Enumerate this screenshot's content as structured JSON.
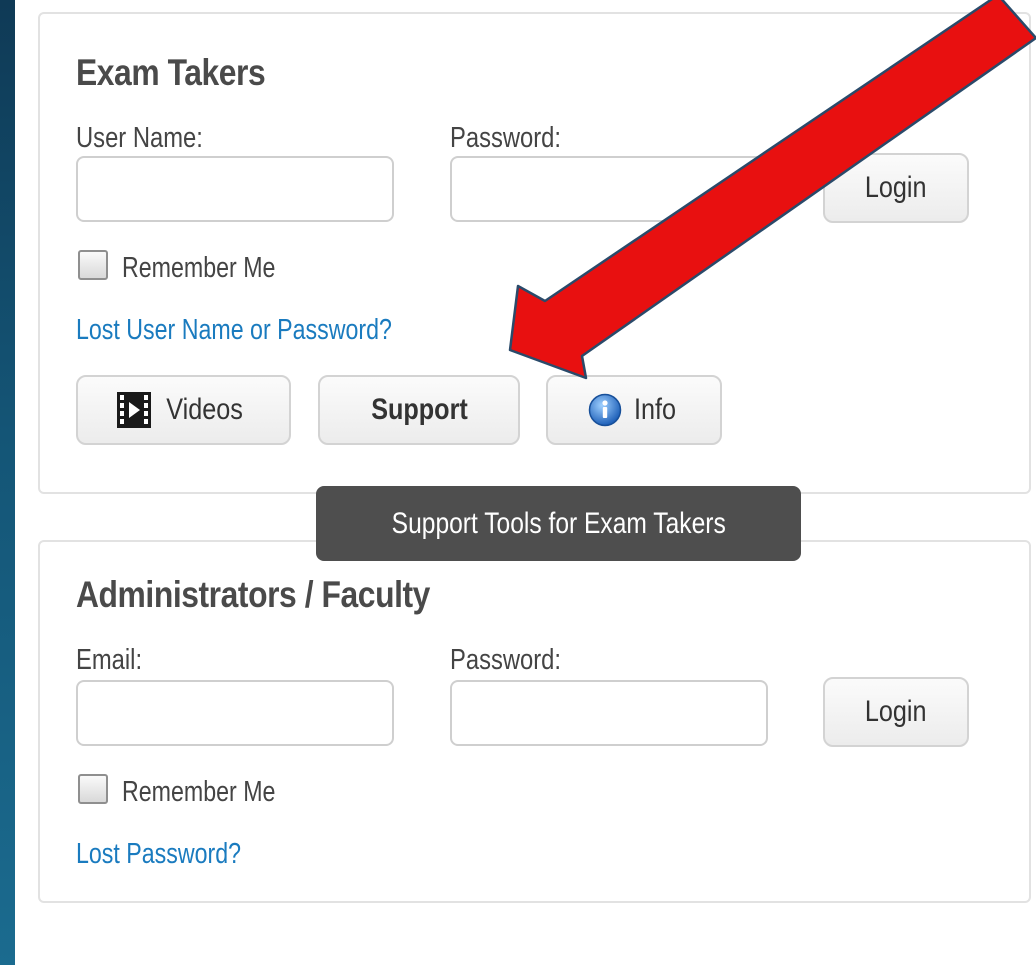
{
  "exam_takers": {
    "title": "Exam Takers",
    "username_label": "User Name:",
    "username_value": "",
    "password_label": "Password:",
    "password_value": "",
    "login_label": "Login",
    "remember_label": "Remember Me",
    "remember_checked": false,
    "lost_link": "Lost User Name or Password?",
    "videos_label": "Videos",
    "videos_icon": "film-icon",
    "support_label": "Support",
    "info_label": "Info",
    "info_icon": "info-icon"
  },
  "tooltip": {
    "text": "Support Tools for Exam Takers"
  },
  "administrators": {
    "title": "Administrators / Faculty",
    "email_label": "Email:",
    "email_value": "",
    "password_label": "Password:",
    "password_value": "",
    "login_label": "Login",
    "remember_label": "Remember Me",
    "remember_checked": false,
    "lost_link": "Lost Password?"
  },
  "annotation": {
    "arrow_color": "#e81010",
    "arrow_outline": "#2a4a6a"
  }
}
